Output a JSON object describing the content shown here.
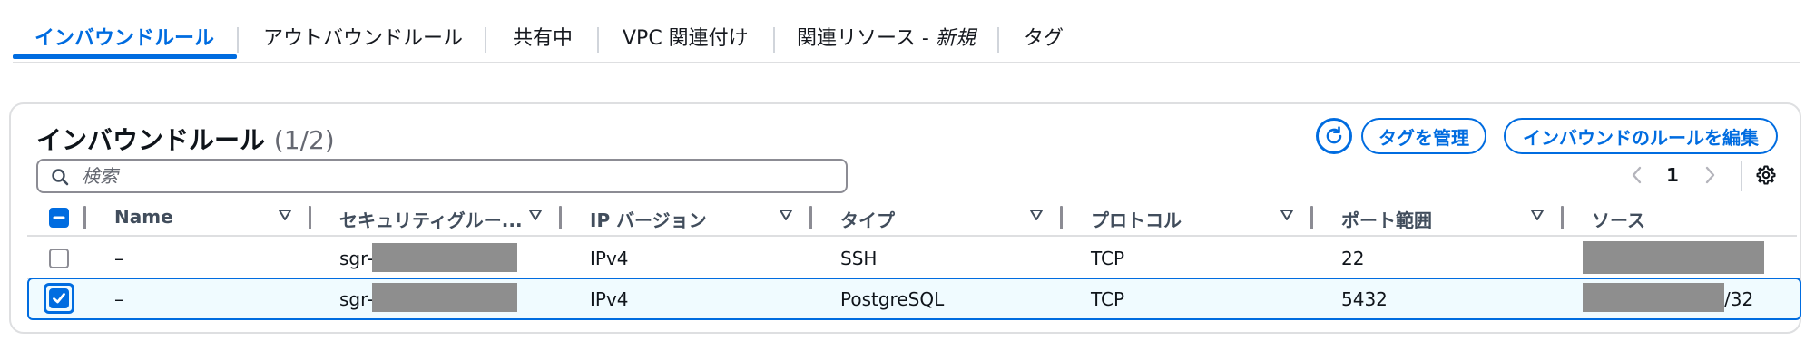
{
  "tabs": [
    {
      "label": "インバウンドルール",
      "active": true
    },
    {
      "label": "アウトバウンドルール",
      "active": false
    },
    {
      "label": "共有中",
      "active": false
    },
    {
      "label": "VPC 関連付け",
      "active": false
    },
    {
      "label_main": "関連リソース - ",
      "label_em": "新規",
      "active": false
    },
    {
      "label": "タグ",
      "active": false
    }
  ],
  "panel": {
    "title": "インバウンドルール",
    "count": "(1/2)",
    "refresh_icon": "refresh-icon",
    "manage_tags_label": "タグを管理",
    "edit_rules_label": "インバウンドのルールを編集"
  },
  "search": {
    "placeholder": "検索",
    "icon": "search-icon"
  },
  "pagination": {
    "current_page": "1"
  },
  "table": {
    "columns": [
      "Name",
      "セキュリティグルー...",
      "IP バージョン",
      "タイプ",
      "プロトコル",
      "ポート範囲",
      "ソース"
    ],
    "rows": [
      {
        "selected": false,
        "name": "–",
        "sgr_prefix": "sgr-0",
        "ip_version": "IPv4",
        "type": "SSH",
        "protocol": "TCP",
        "port_range": "22",
        "source_suffix": ""
      },
      {
        "selected": true,
        "name": "–",
        "sgr_prefix": "sgr-0",
        "ip_version": "IPv4",
        "type": "PostgreSQL",
        "protocol": "TCP",
        "port_range": "5432",
        "source_suffix": "/32"
      }
    ]
  },
  "colors": {
    "accent": "#006ce0",
    "selected_row_bg": "#f0fbff",
    "redaction": "#8e8e8e"
  }
}
